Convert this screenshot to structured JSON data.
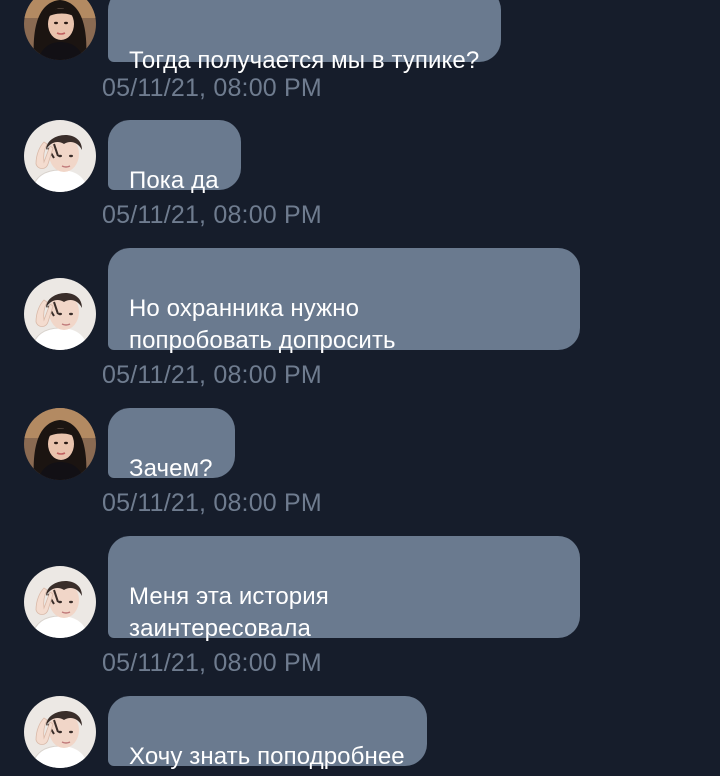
{
  "messages": [
    {
      "sender": "girl",
      "text": "Тогда получается мы в тупике?",
      "time": "05/11/21, 08:00 PM"
    },
    {
      "sender": "boy",
      "text": "Пока да",
      "time": "05/11/21, 08:00 PM"
    },
    {
      "sender": "boy",
      "text": "Но охранника нужно\nпопробовать допросить",
      "time": "05/11/21, 08:00 PM"
    },
    {
      "sender": "girl",
      "text": "Зачем?",
      "time": "05/11/21, 08:00 PM"
    },
    {
      "sender": "boy",
      "text": "Меня эта история\nзаинтересовала",
      "time": "05/11/21, 08:00 PM"
    },
    {
      "sender": "boy",
      "text": "Хочу знать поподробнее",
      "time": ""
    }
  ],
  "colors": {
    "background": "#161d2b",
    "bubble": "#6a7a8f",
    "timestamp": "#6f7c8f",
    "text": "#ffffff"
  }
}
